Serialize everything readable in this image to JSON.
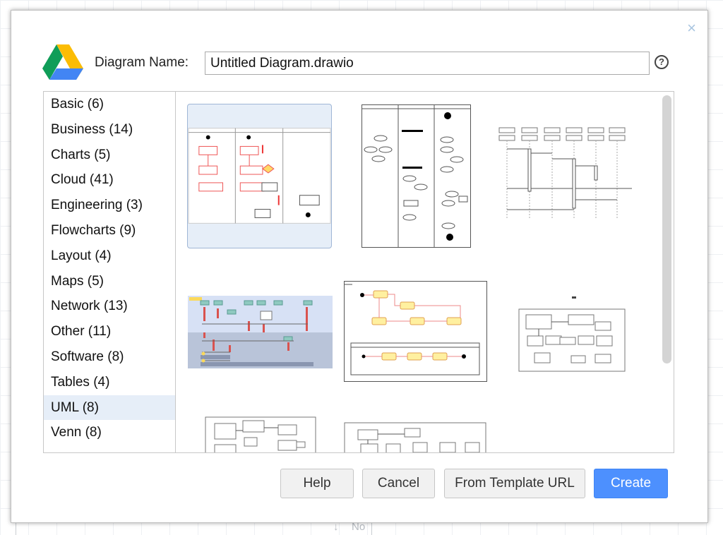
{
  "background": {
    "connector_label": "No"
  },
  "dialog": {
    "close_glyph": "×",
    "name_label": "Diagram Name:",
    "name_value": "Untitled Diagram.drawio",
    "help_glyph": "?",
    "categories": [
      {
        "label": "Basic (6)"
      },
      {
        "label": "Business (14)"
      },
      {
        "label": "Charts (5)"
      },
      {
        "label": "Cloud (41)"
      },
      {
        "label": "Engineering (3)"
      },
      {
        "label": "Flowcharts (9)"
      },
      {
        "label": "Layout (4)"
      },
      {
        "label": "Maps (5)"
      },
      {
        "label": "Network (13)"
      },
      {
        "label": "Other (11)"
      },
      {
        "label": "Software (8)"
      },
      {
        "label": "Tables (4)"
      },
      {
        "label": "UML (8)"
      },
      {
        "label": "Venn (8)"
      }
    ],
    "selected_category": "UML (8)",
    "templates_visible": 8,
    "buttons": {
      "help": "Help",
      "cancel": "Cancel",
      "template_url": "From Template URL",
      "create": "Create"
    }
  },
  "colors": {
    "accent": "#4d90fe",
    "selected_bg": "#e6eef8"
  },
  "icons": [
    "google-drive-icon",
    "close-icon",
    "help-circle-icon"
  ]
}
